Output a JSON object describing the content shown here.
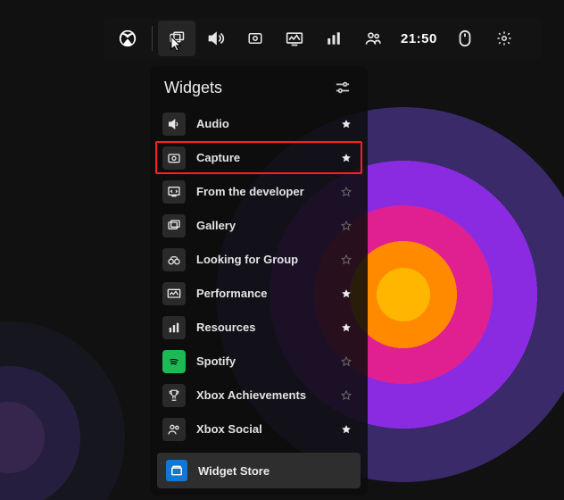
{
  "toolbar": {
    "items": [
      {
        "name": "xbox",
        "icon": "xbox"
      },
      {
        "name": "widgets",
        "icon": "overlay",
        "active": true
      },
      {
        "name": "audio",
        "icon": "sound"
      },
      {
        "name": "capture",
        "icon": "camera"
      },
      {
        "name": "performance",
        "icon": "perf"
      },
      {
        "name": "resources",
        "icon": "bars"
      },
      {
        "name": "group",
        "icon": "people"
      }
    ],
    "time": "21:50",
    "right": [
      {
        "name": "mouse",
        "icon": "mouse"
      },
      {
        "name": "settings",
        "icon": "gear"
      }
    ]
  },
  "panel": {
    "title": "Widgets",
    "items": [
      {
        "icon": "sound-small",
        "label": "Audio",
        "starred": true
      },
      {
        "icon": "camera",
        "label": "Capture",
        "starred": true,
        "highlight": true
      },
      {
        "icon": "dev",
        "label": "From the developer",
        "starred": false
      },
      {
        "icon": "gallery",
        "label": "Gallery",
        "starred": false
      },
      {
        "icon": "binoculars",
        "label": "Looking for Group",
        "starred": false
      },
      {
        "icon": "perf",
        "label": "Performance",
        "starred": true
      },
      {
        "icon": "bars",
        "label": "Resources",
        "starred": true
      },
      {
        "icon": "spotify",
        "label": "Spotify",
        "starred": false
      },
      {
        "icon": "trophy",
        "label": "Xbox Achievements",
        "starred": false
      },
      {
        "icon": "social",
        "label": "Xbox Social",
        "starred": true
      }
    ],
    "store_label": "Widget Store"
  }
}
